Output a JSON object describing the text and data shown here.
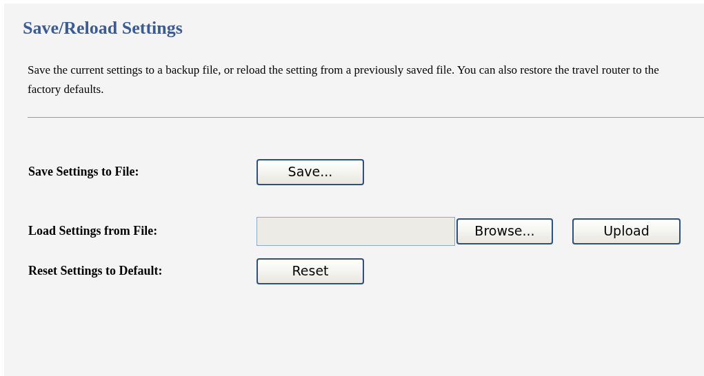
{
  "title": "Save/Reload Settings",
  "description": "Save the current settings to a backup file, or reload the setting from a previously saved file. You can also restore the travel router to the factory defaults.",
  "rows": [
    {
      "kind": "button",
      "label": "Save Settings to File:",
      "buttons": [
        "Save..."
      ]
    },
    {
      "kind": "file",
      "label": "Load Settings from File:",
      "buttons": [
        "Browse...",
        "Upload"
      ]
    },
    {
      "kind": "button",
      "label": "Reset Settings to Default:",
      "buttons": [
        "Reset"
      ]
    }
  ]
}
